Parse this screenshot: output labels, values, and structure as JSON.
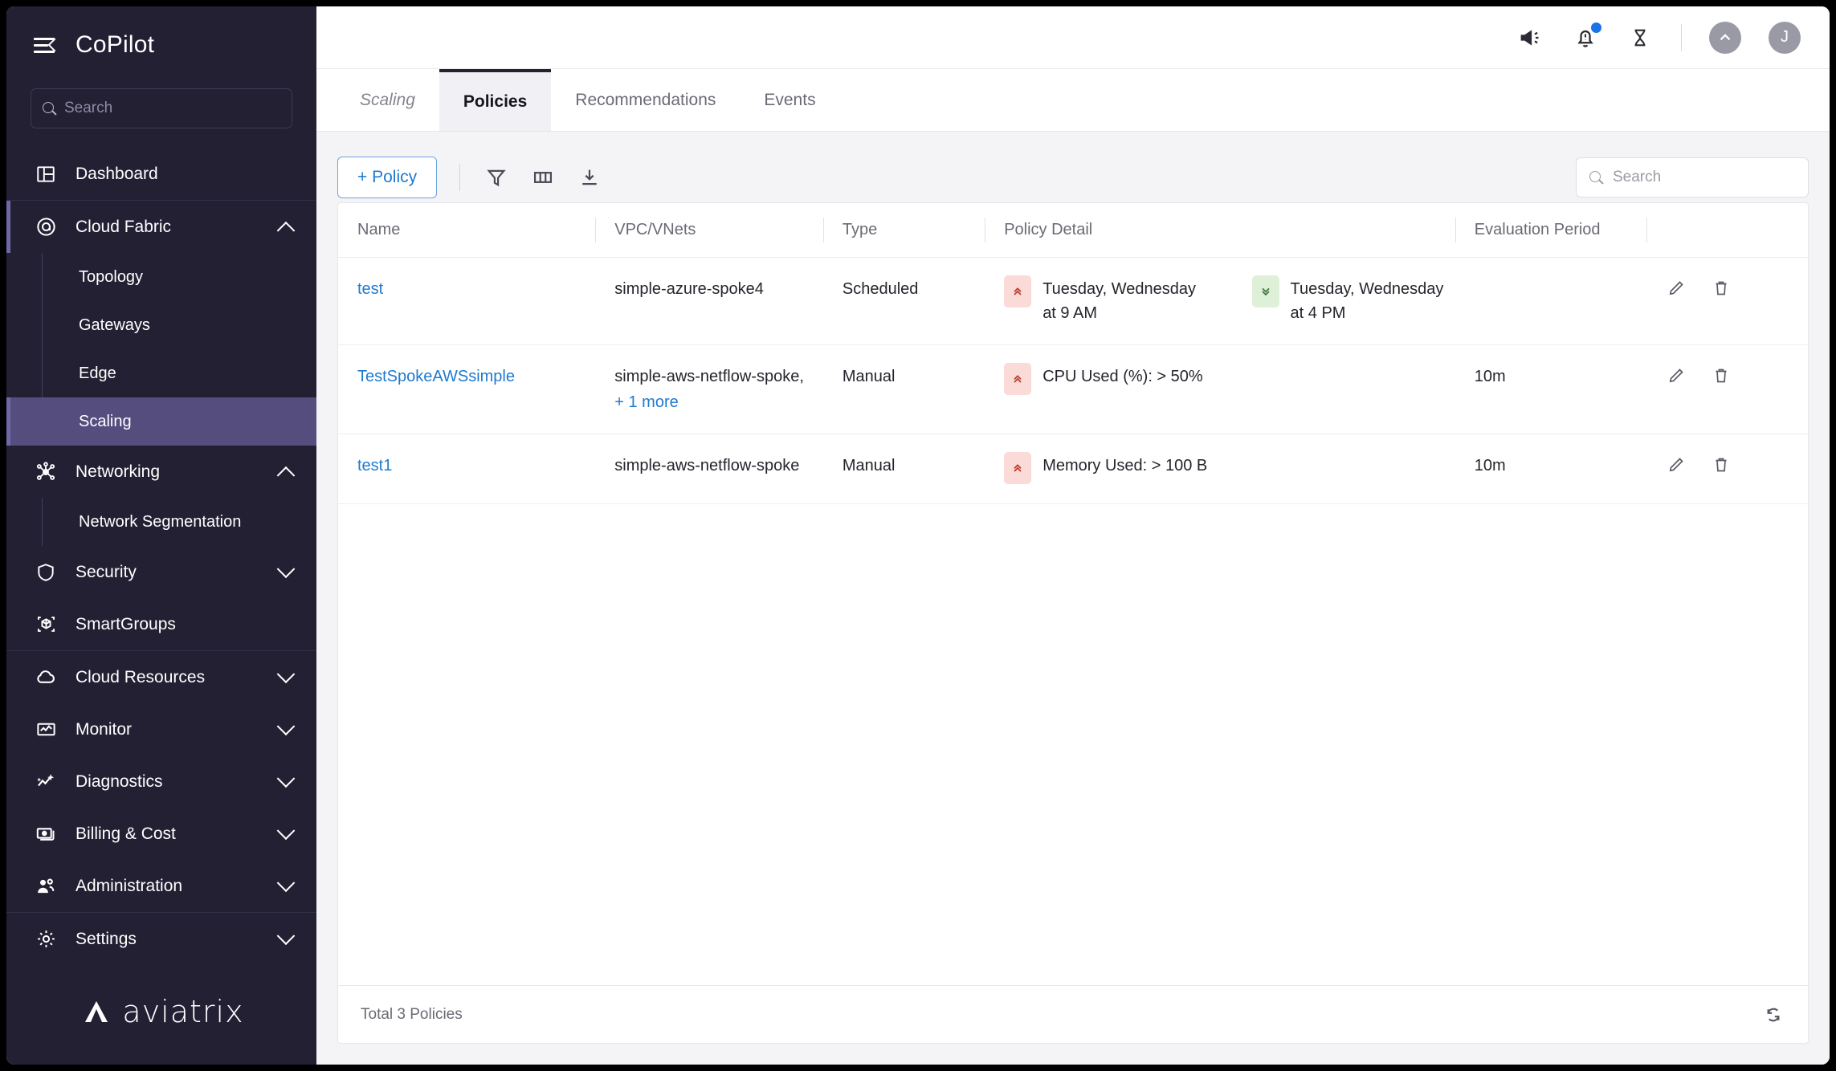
{
  "app": {
    "brand": "CoPilot",
    "logo_word": "aviatrix"
  },
  "sidebar": {
    "search_placeholder": "Search",
    "items": [
      {
        "label": "Dashboard",
        "icon": "dashboard-icon",
        "expandable": false
      },
      {
        "label": "Cloud Fabric",
        "icon": "cloud-fabric-icon",
        "expandable": true,
        "expanded": true,
        "active_parent": true,
        "children": [
          {
            "label": "Topology",
            "selected": false
          },
          {
            "label": "Gateways",
            "selected": false
          },
          {
            "label": "Edge",
            "selected": false
          },
          {
            "label": "Scaling",
            "selected": true
          }
        ]
      },
      {
        "label": "Networking",
        "icon": "networking-icon",
        "expandable": true,
        "expanded": true,
        "children": [
          {
            "label": "Network Segmentation",
            "selected": false
          }
        ]
      },
      {
        "label": "Security",
        "icon": "shield-icon",
        "expandable": true,
        "expanded": false
      },
      {
        "label": "SmartGroups",
        "icon": "smartgroups-icon",
        "expandable": false
      },
      {
        "label": "Cloud Resources",
        "icon": "cloud-icon",
        "expandable": true,
        "expanded": false
      },
      {
        "label": "Monitor",
        "icon": "monitor-icon",
        "expandable": true,
        "expanded": false
      },
      {
        "label": "Diagnostics",
        "icon": "diagnostics-icon",
        "expandable": true,
        "expanded": false
      },
      {
        "label": "Billing & Cost",
        "icon": "billing-icon",
        "expandable": true,
        "expanded": false
      },
      {
        "label": "Administration",
        "icon": "administration-icon",
        "expandable": true,
        "expanded": false
      },
      {
        "label": "Settings",
        "icon": "gear-icon",
        "expandable": true,
        "expanded": false
      }
    ]
  },
  "topbar": {
    "icons": [
      "announcement-icon",
      "notification-bell-icon",
      "hourglass-icon"
    ],
    "notification_badge": true,
    "collapse_label": "",
    "avatar_initial": "J"
  },
  "tabs": {
    "breadcrumb_label": "Scaling",
    "items": [
      {
        "label": "Policies",
        "active": true
      },
      {
        "label": "Recommendations",
        "active": false
      },
      {
        "label": "Events",
        "active": false
      }
    ]
  },
  "toolbar": {
    "add_policy_label": "+ Policy",
    "filter_icon": "filter-icon",
    "columns_icon": "columns-icon",
    "download_icon": "download-icon",
    "search_placeholder": "Search"
  },
  "table": {
    "columns": [
      "Name",
      "VPC/VNets",
      "Type",
      "Policy Detail",
      "Evaluation Period",
      ""
    ],
    "rows": [
      {
        "name": "test",
        "vpc": "simple-azure-spoke4",
        "vpc_more": "",
        "type": "Scheduled",
        "detail_up": "Tuesday, Wednesday at 9 AM",
        "detail_down": "Tuesday, Wednesday at 4 PM",
        "evaluation_period": ""
      },
      {
        "name": "TestSpokeAWSsimple",
        "vpc": "simple-aws-netflow-spoke,",
        "vpc_more": "+ 1 more",
        "type": "Manual",
        "detail_up": "CPU Used (%): > 50%",
        "detail_down": "",
        "evaluation_period": "10m"
      },
      {
        "name": "test1",
        "vpc": "simple-aws-netflow-spoke",
        "vpc_more": "",
        "type": "Manual",
        "detail_up": "Memory Used: > 100 B",
        "detail_down": "",
        "evaluation_period": "10m"
      }
    ],
    "row_actions": [
      "edit-icon",
      "delete-icon"
    ],
    "footer_total": "Total 3 Policies",
    "refresh_icon": "refresh-icon"
  },
  "colors": {
    "sidebar_bg": "#232034",
    "sidebar_selected": "#544d7e",
    "accent_blue": "#1e7ad0",
    "badge_blue": "#1a73e8",
    "pill_up_bg": "#fadbd7",
    "pill_down_bg": "#dff0d8"
  }
}
